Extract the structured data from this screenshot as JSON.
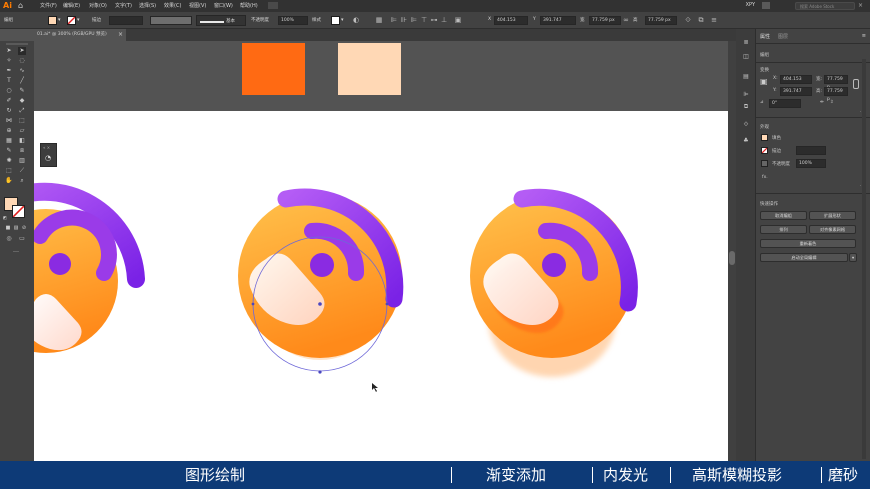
{
  "app": {
    "logo": "Ai",
    "menu": [
      "文件(F)",
      "编辑(E)",
      "对象(O)",
      "文字(T)",
      "选择(S)",
      "效果(C)",
      "视图(V)",
      "窗口(W)",
      "帮助(H)"
    ],
    "layout_menu": "",
    "workspace": "XPY",
    "search_placeholder": "搜索 Adobe Stock"
  },
  "control_bar": {
    "selection_label": "编组",
    "stroke_label": "描边",
    "stroke_profile": "基本",
    "opacity_label": "不透明度",
    "opacity_value": "100%",
    "style_label": "样式",
    "x_label": "X",
    "x_value": "404.153",
    "y_label": "Y",
    "y_value": "391.747",
    "w_label": "宽",
    "w_value": "77.759 px",
    "h_label": "高",
    "h_value": "77.759 px"
  },
  "document": {
    "tab_title": "01.ai* @ 300% (RGB/GPU 预览)",
    "close_glyph": "×"
  },
  "properties_panel": {
    "tabs": [
      "属性",
      "图层"
    ],
    "group_label": "编组",
    "transform_label": "变换",
    "x_label": "X:",
    "x_value": "404.153",
    "y_label": "Y:",
    "y_value": "391.747",
    "w_label": "宽:",
    "w_value": "77.759 p",
    "h_label": "高:",
    "h_value": "77.759 p",
    "angle_value": "0°",
    "appearance_label": "外观",
    "fill_label": "填色",
    "stroke_label": "描边",
    "opacity_label": "不透明度",
    "opacity_value": "100%",
    "fx_label": "fx.",
    "quick_actions_label": "快速操作",
    "buttons": [
      "取消编组",
      "扩展形状",
      "排列",
      "对齐像素网格",
      "重新着色",
      "启动全局编辑"
    ]
  },
  "subtitle_bar": {
    "segments": [
      "图形绘制",
      "渐变添加",
      "内发光",
      "高斯模糊投影",
      "磨砂"
    ]
  },
  "colors": {
    "accent_orange": "#ff6a13",
    "peach_swatch": "#ffd8b5",
    "purple": "#8a2be2",
    "subtitle_bg": "#0d3a77"
  }
}
